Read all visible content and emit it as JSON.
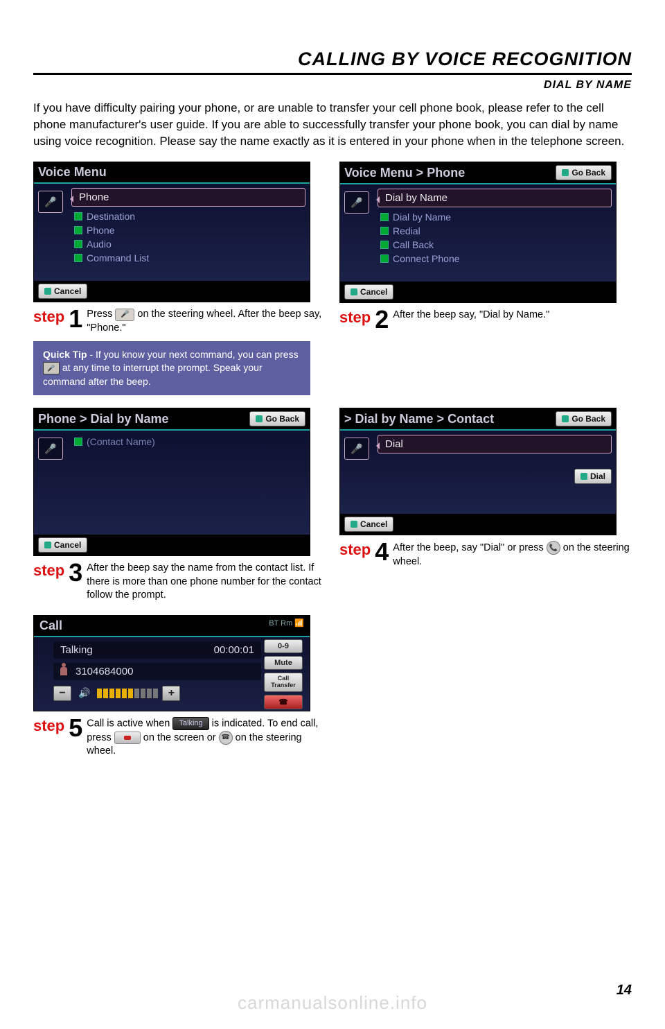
{
  "header": {
    "title": "CALLING BY VOICE RECOGNITION",
    "subtitle": "DIAL BY NAME"
  },
  "intro": "If you have difficulty pairing your phone, or are unable to transfer your cell phone book, please refer to the cell phone manufacturer's user guide.  If you are able to successfully transfer your phone book, you can dial by name using voice recognition. Please say the name exactly as it is entered in your phone when in the telephone screen.",
  "screens": {
    "s1": {
      "title": "Voice Menu",
      "selected": "Phone",
      "options": [
        "Destination",
        "Phone",
        "Audio",
        "Command List"
      ],
      "cancel": "Cancel"
    },
    "s2": {
      "title": "Voice Menu > Phone",
      "goback": "Go Back",
      "selected": "Dial by Name",
      "options": [
        "Dial by Name",
        "Redial",
        "Call Back",
        "Connect Phone"
      ],
      "cancel": "Cancel"
    },
    "s3": {
      "title": "Phone > Dial by Name",
      "goback": "Go Back",
      "placeholder": "(Contact Name)",
      "cancel": "Cancel"
    },
    "s4": {
      "title": "> Dial by Name > Contact",
      "goback": "Go Back",
      "selected": "Dial",
      "dialbtn": "Dial",
      "cancel": "Cancel"
    },
    "s5": {
      "title": "Call",
      "status_icons": "BT  Rm  📶",
      "talking": "Talking",
      "time": "00:00:01",
      "number": "3104684000",
      "side": {
        "keypad": "0-9",
        "mute": "Mute",
        "transfer": "Call Transfer"
      }
    }
  },
  "steps": {
    "word": "step",
    "n1": "1",
    "d1_a": "Press ",
    "d1_b": " on the steering wheel. After the beep say, \"Phone.\"",
    "n2": "2",
    "d2": "After the beep say, \"Dial by Name.\"",
    "n3": "3",
    "d3": "After the beep say the name from the contact list. If there is more than one phone number for the contact follow the prompt.",
    "n4": "4",
    "d4_a": "After the beep, say \"Dial\" or press ",
    "d4_b": " on the steering wheel.",
    "n5": "5",
    "d5_a": "Call is active when ",
    "d5_b": " is indicated. To end call, press ",
    "d5_c": " on the screen or ",
    "d5_d": " on the steering wheel."
  },
  "tip": {
    "bold": "Quick Tip",
    "a": " - If you know your next command, you can press ",
    "b": " at any time to interrupt the prompt. Speak your command after the beep."
  },
  "talking_label": "Talking",
  "page_number": "14",
  "watermark": "carmanualsonline.info"
}
